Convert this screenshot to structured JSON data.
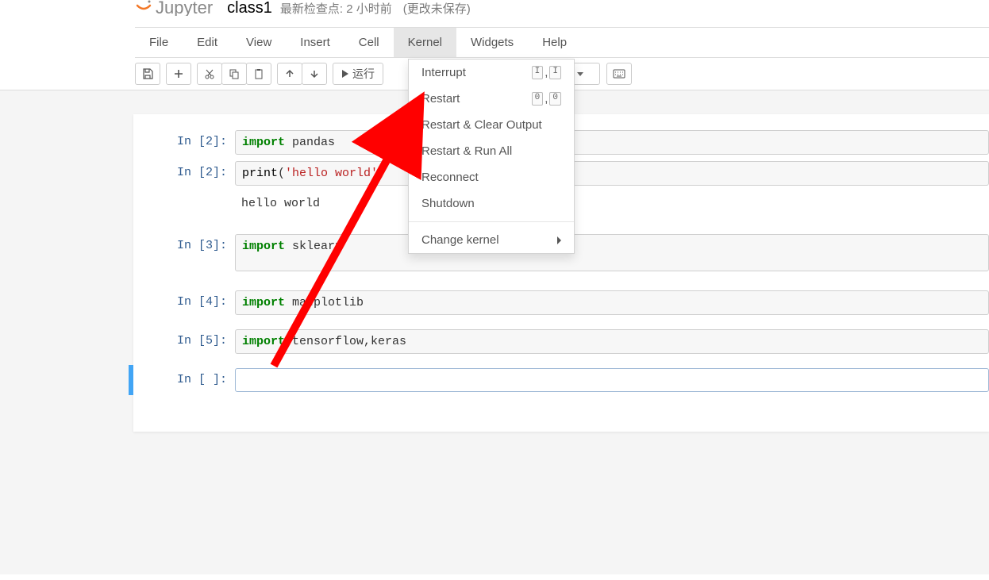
{
  "header": {
    "logo_text": "Jupyter",
    "notebook_title": "class1",
    "checkpoint": "最新检查点: 2 小时前",
    "unsaved": "(更改未保存)"
  },
  "menubar": [
    "File",
    "Edit",
    "View",
    "Insert",
    "Cell",
    "Kernel",
    "Widgets",
    "Help"
  ],
  "toolbar": {
    "run_label": "运行"
  },
  "kernel_menu": {
    "interrupt": "Interrupt",
    "interrupt_key1": "I",
    "interrupt_key2": "I",
    "restart": "Restart",
    "restart_key1": "0",
    "restart_key2": "0",
    "restart_clear": "Restart & Clear Output",
    "restart_run": "Restart & Run All",
    "reconnect": "Reconnect",
    "shutdown": "Shutdown",
    "change_kernel": "Change kernel"
  },
  "cells": {
    "p1": "In  [2]:",
    "c1_kw": "import",
    "c1_rest": " pandas",
    "p2": "In  [2]:",
    "c2_fn": "print",
    "c2_paren1": "(",
    "c2_str": "'hello world'",
    "c2_paren2": ")",
    "c2_out": "hello world",
    "p3": "In  [3]:",
    "c3_kw": "import",
    "c3_rest": " sklearn",
    "p4": "In  [4]:",
    "c4_kw": "import",
    "c4_rest": " matplotlib",
    "p5": "In  [5]:",
    "c5_kw": "import",
    "c5_rest": " tensorflow,keras",
    "p6": "In  [ ]:"
  }
}
